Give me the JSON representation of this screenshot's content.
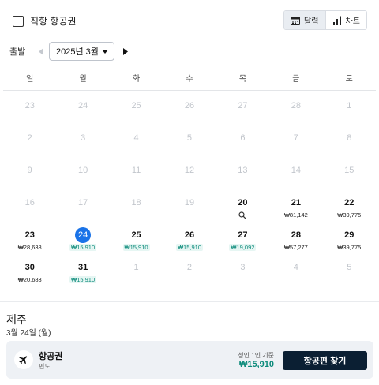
{
  "filters": {
    "direct_label": "직항 항공권"
  },
  "view_toggle": {
    "calendar_label": "달력",
    "chart_label": "차트"
  },
  "month_nav": {
    "depart_label": "출발",
    "month_value": "2025년 3월"
  },
  "weekdays": [
    "일",
    "월",
    "화",
    "수",
    "목",
    "금",
    "토"
  ],
  "days": [
    {
      "n": "23",
      "price": "",
      "state": "inactive"
    },
    {
      "n": "24",
      "price": "",
      "state": "inactive"
    },
    {
      "n": "25",
      "price": "",
      "state": "inactive"
    },
    {
      "n": "26",
      "price": "",
      "state": "inactive"
    },
    {
      "n": "27",
      "price": "",
      "state": "inactive"
    },
    {
      "n": "28",
      "price": "",
      "state": "inactive"
    },
    {
      "n": "1",
      "price": "",
      "state": "inactive"
    },
    {
      "n": "2",
      "price": "",
      "state": "inactive"
    },
    {
      "n": "3",
      "price": "",
      "state": "inactive"
    },
    {
      "n": "4",
      "price": "",
      "state": "inactive"
    },
    {
      "n": "5",
      "price": "",
      "state": "inactive"
    },
    {
      "n": "6",
      "price": "",
      "state": "inactive"
    },
    {
      "n": "7",
      "price": "",
      "state": "inactive"
    },
    {
      "n": "8",
      "price": "",
      "state": "inactive"
    },
    {
      "n": "9",
      "price": "",
      "state": "inactive"
    },
    {
      "n": "10",
      "price": "",
      "state": "inactive"
    },
    {
      "n": "11",
      "price": "",
      "state": "inactive"
    },
    {
      "n": "12",
      "price": "",
      "state": "inactive"
    },
    {
      "n": "13",
      "price": "",
      "state": "inactive"
    },
    {
      "n": "14",
      "price": "",
      "state": "inactive"
    },
    {
      "n": "15",
      "price": "",
      "state": "inactive"
    },
    {
      "n": "16",
      "price": "",
      "state": "inactive"
    },
    {
      "n": "17",
      "price": "",
      "state": "inactive"
    },
    {
      "n": "18",
      "price": "",
      "state": "inactive"
    },
    {
      "n": "19",
      "price": "",
      "state": "inactive"
    },
    {
      "n": "20",
      "price": "",
      "state": "active",
      "icon": "search"
    },
    {
      "n": "21",
      "price": "₩81,142",
      "state": "active"
    },
    {
      "n": "22",
      "price": "₩39,775",
      "state": "active"
    },
    {
      "n": "23",
      "price": "₩28,638",
      "state": "active"
    },
    {
      "n": "24",
      "price": "₩15,910",
      "state": "selected",
      "tone": "low"
    },
    {
      "n": "25",
      "price": "₩15,910",
      "state": "active",
      "tone": "low"
    },
    {
      "n": "26",
      "price": "₩15,910",
      "state": "active",
      "tone": "low"
    },
    {
      "n": "27",
      "price": "₩19,092",
      "state": "active",
      "tone": "low"
    },
    {
      "n": "28",
      "price": "₩57,277",
      "state": "active"
    },
    {
      "n": "29",
      "price": "₩39,775",
      "state": "active"
    },
    {
      "n": "30",
      "price": "₩20,683",
      "state": "active"
    },
    {
      "n": "31",
      "price": "₩15,910",
      "state": "active",
      "tone": "low"
    },
    {
      "n": "1",
      "price": "",
      "state": "inactive"
    },
    {
      "n": "2",
      "price": "",
      "state": "inactive"
    },
    {
      "n": "3",
      "price": "",
      "state": "inactive"
    },
    {
      "n": "4",
      "price": "",
      "state": "inactive"
    },
    {
      "n": "5",
      "price": "",
      "state": "inactive"
    }
  ],
  "summary": {
    "destination": "제주",
    "date": "3월 24일 (월)",
    "card_title": "항공권",
    "card_sub": "편도",
    "price_label": "성인 1인 기준",
    "price_value": "₩15,910",
    "find_button": "항공편 찾기"
  },
  "colors": {
    "selected": "#1a73e8",
    "low_price": "#0b8a7a",
    "button_bg": "#0b1f33"
  }
}
